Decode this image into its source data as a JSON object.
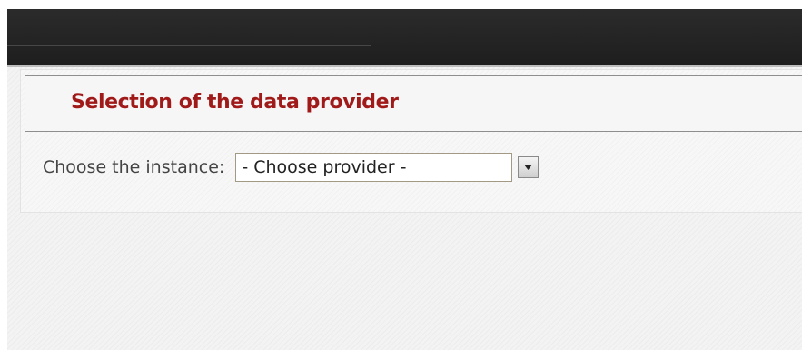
{
  "panel": {
    "title": "Selection of the data provider"
  },
  "form": {
    "instance_label": "Choose the instance:",
    "provider_select": {
      "selected": "- Choose provider -",
      "icon": "chevron-down-icon"
    }
  },
  "colors": {
    "title": "#a11a1a",
    "top_bar": "#232323",
    "background": "#f3f3f3"
  }
}
